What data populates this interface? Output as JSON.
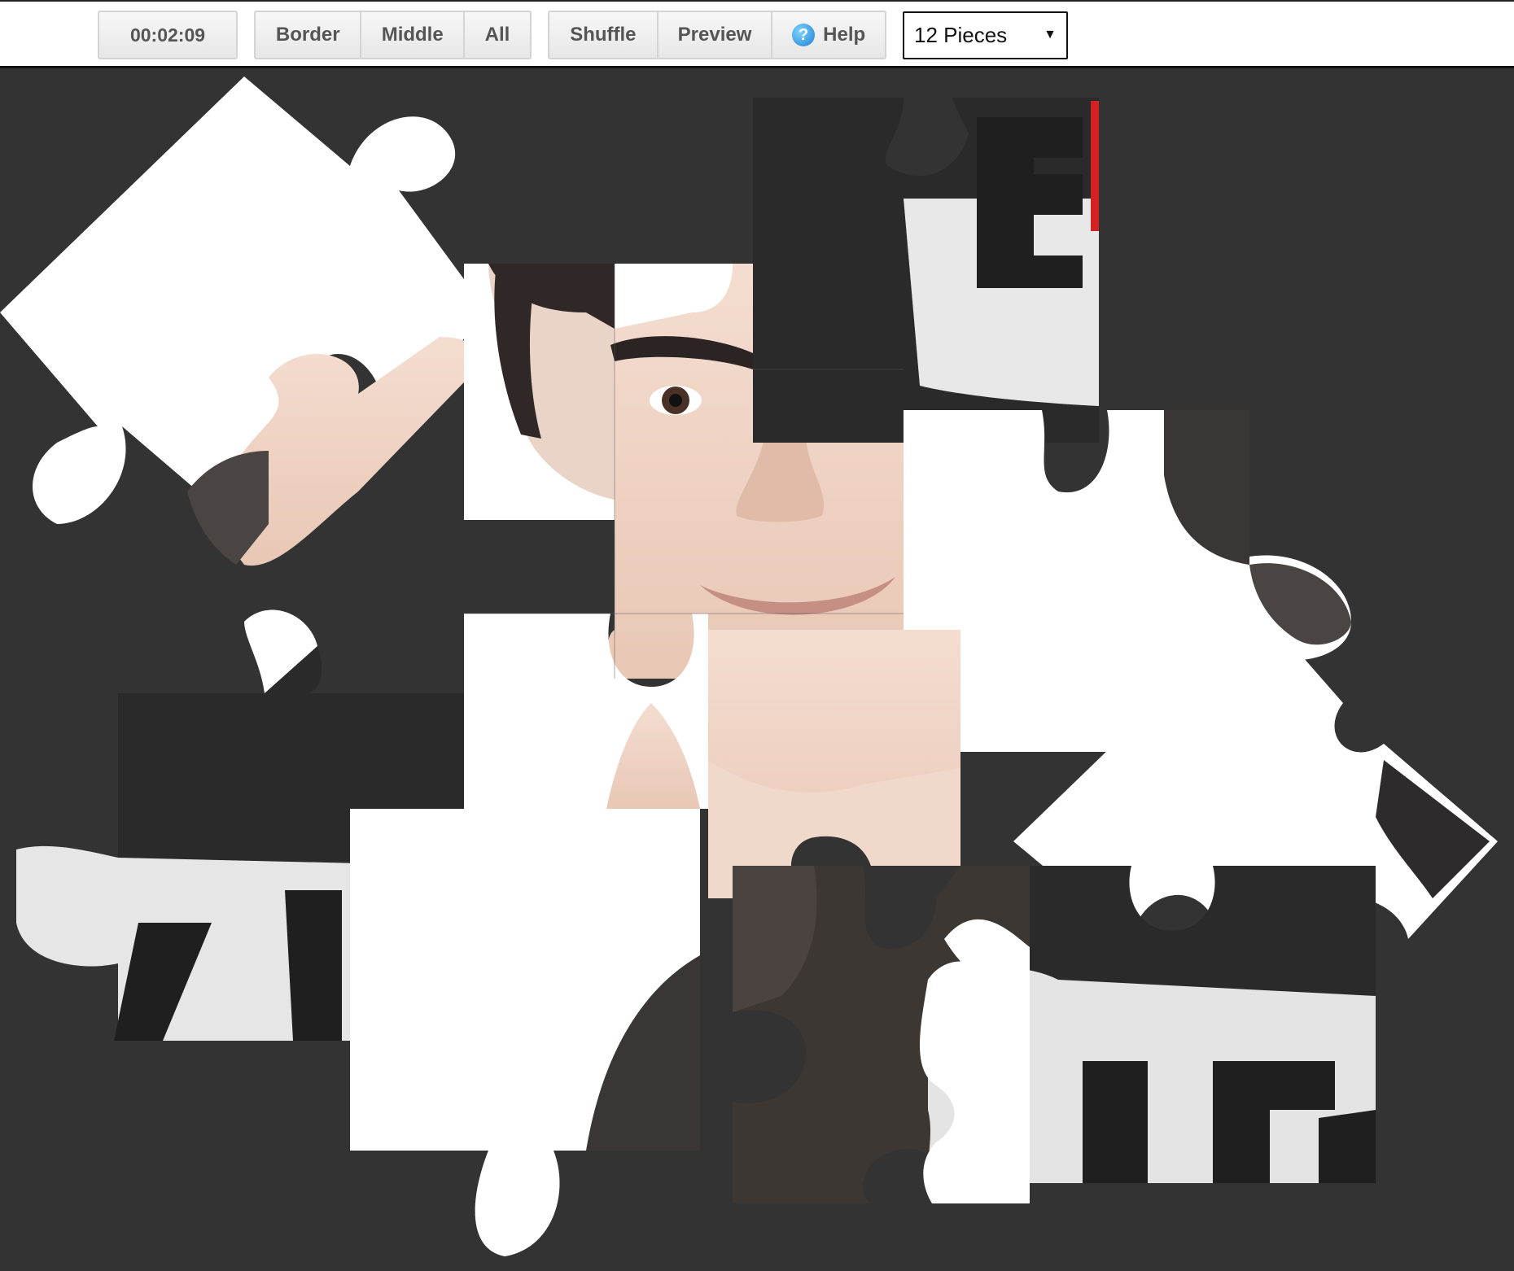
{
  "toolbar": {
    "timer": "00:02:09",
    "buttons_group1": [
      {
        "label": "Border"
      },
      {
        "label": "Middle"
      },
      {
        "label": "All"
      }
    ],
    "shuffle_label": "Shuffle",
    "preview_label": "Preview",
    "help_label": "Help",
    "pieces_select": "12 Pieces"
  },
  "board": {
    "background": "#333333",
    "piece_count": 12
  }
}
